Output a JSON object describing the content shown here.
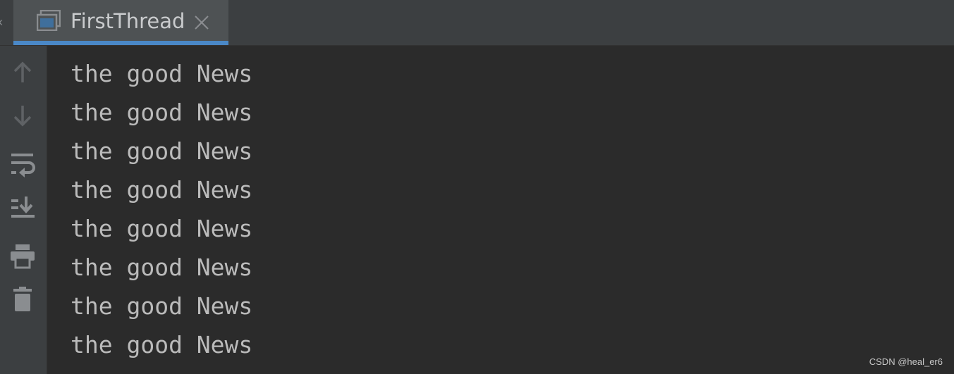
{
  "tab": {
    "title": "FirstThread",
    "icon": "console-window-icon",
    "close_icon": "close-icon"
  },
  "toolbar": {
    "items": [
      {
        "name": "up-arrow-icon",
        "tooltip": "Up the Stack Trace"
      },
      {
        "name": "down-arrow-icon",
        "tooltip": "Down the Stack Trace"
      },
      {
        "name": "soft-wrap-icon",
        "tooltip": "Soft-Wrap"
      },
      {
        "name": "scroll-to-end-icon",
        "tooltip": "Scroll to the End"
      },
      {
        "name": "print-icon",
        "tooltip": "Print"
      },
      {
        "name": "trash-icon",
        "tooltip": "Clear All"
      }
    ]
  },
  "console": {
    "lines": [
      "the good News",
      "the good News",
      "the good News",
      "the good News",
      "the good News",
      "the good News",
      "the good News",
      "the good News"
    ]
  },
  "watermark": "CSDN @heal_er6",
  "colors": {
    "background": "#2b2b2b",
    "panel": "#3c3f41",
    "active_tab": "#4e5254",
    "accent": "#4a88c7",
    "text": "#bbbbbb",
    "icon": "#8a8d90"
  }
}
